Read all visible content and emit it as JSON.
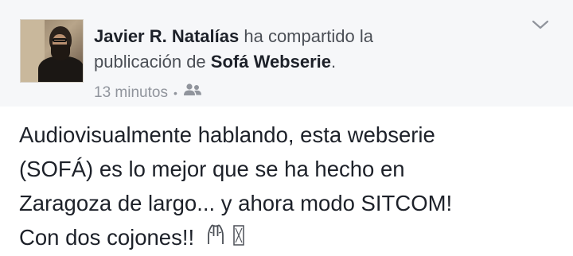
{
  "post": {
    "author_name": "Javier R. Natalías",
    "share_text_1": "ha compartido la",
    "share_text_2": "publicación de",
    "shared_page": "Sofá Webserie",
    "share_end": ".",
    "timestamp": "13 minutos",
    "separator": "•",
    "audience_icon": "friends-icon",
    "menu_icon": "chevron-down-icon",
    "body_lines": [
      "Audiovisualmente hablando, esta webserie",
      "(SOFÁ) es lo mejor que se ha hecho en",
      "Zaragoza de largo... y ahora modo SITCOM!",
      "Con dos cojones!!"
    ],
    "trailing_emoji": "praying-hands-icon"
  },
  "colors": {
    "header_bg": "#f6f7f9",
    "text_primary": "#1d2129",
    "text_secondary": "#4b4f56",
    "meta": "#90949c"
  }
}
